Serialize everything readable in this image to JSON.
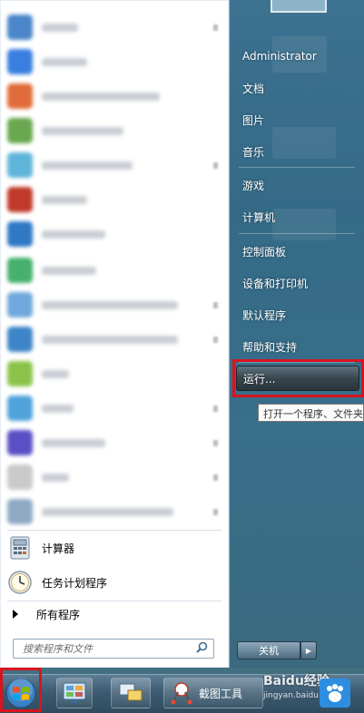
{
  "start_menu": {
    "pinned_programs": [
      {
        "label": "计算器",
        "icon": "calculator-icon"
      },
      {
        "label": "任务计划程序",
        "icon": "task-scheduler-icon"
      }
    ],
    "all_programs_label": "所有程序",
    "search": {
      "placeholder": "搜索程序和文件",
      "icon": "search-icon"
    }
  },
  "right_pane": {
    "user": "Administrator",
    "items": [
      "文档",
      "图片",
      "音乐",
      "游戏",
      "计算机",
      "控制面板",
      "设备和打印机",
      "默认程序",
      "帮助和支持",
      "运行..."
    ],
    "shutdown_label": "关机"
  },
  "tooltip": "打开一个程序、文件夹",
  "taskbar": {
    "items": [
      {
        "label": "截图工具",
        "icon": "snipping-tool-icon"
      }
    ]
  },
  "watermark": {
    "brand": "Baidu经验",
    "url": "jingyan.baidu.com"
  },
  "colors": {
    "highlight_box": "#d7141e",
    "start_menu_right": "#3c6e8c"
  }
}
